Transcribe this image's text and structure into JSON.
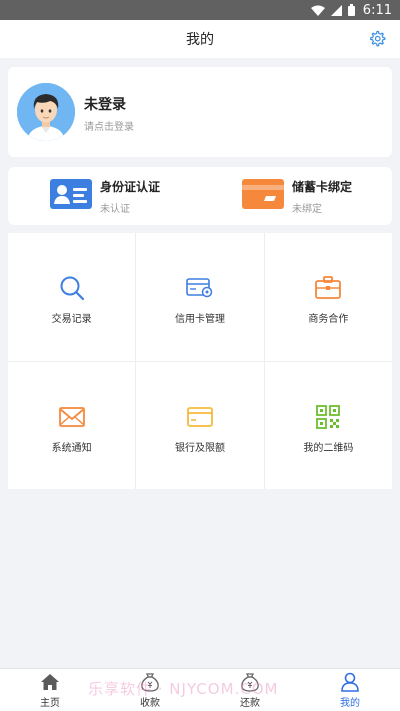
{
  "status_bar": {
    "time": "6:11"
  },
  "header": {
    "title": "我的"
  },
  "profile": {
    "name": "未登录",
    "hint": "请点击登录"
  },
  "verify": [
    {
      "title": "身份证认证",
      "status": "未认证",
      "icon": "id-card-icon",
      "color": "#3d7fe0"
    },
    {
      "title": "储蓄卡绑定",
      "status": "未绑定",
      "icon": "bank-card-icon",
      "color": "#f5883a"
    }
  ],
  "grid": [
    {
      "label": "交易记录",
      "icon": "search-icon",
      "color": "#3d7fe0"
    },
    {
      "label": "信用卡管理",
      "icon": "credit-card-gear-icon",
      "color": "#3d7fe0"
    },
    {
      "label": "商务合作",
      "icon": "briefcase-icon",
      "color": "#f5883a"
    },
    {
      "label": "系统通知",
      "icon": "envelope-icon",
      "color": "#f5883a"
    },
    {
      "label": "银行及限额",
      "icon": "card-icon",
      "color": "#f5b93a"
    },
    {
      "label": "我的二维码",
      "icon": "qr-code-icon",
      "color": "#6bbf2f"
    }
  ],
  "tabs": [
    {
      "label": "主页",
      "icon": "home-icon"
    },
    {
      "label": "收款",
      "icon": "money-bag-icon"
    },
    {
      "label": "还款",
      "icon": "money-bag-icon"
    },
    {
      "label": "我的",
      "icon": "user-icon",
      "active": true
    }
  ],
  "watermark": "乐享软件 · NJYCOM.COM",
  "colors": {
    "accent": "#2f6fe0",
    "background": "#f2f3f7"
  }
}
